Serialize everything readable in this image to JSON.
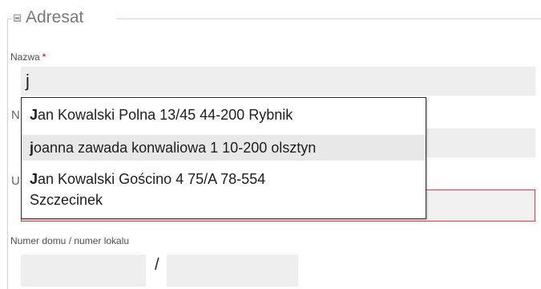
{
  "fieldset": {
    "legend": "Adresat",
    "collapse_icon": "minus-box-icon"
  },
  "fields": {
    "name_label": "Nazwa",
    "name_required_mark": "*",
    "name_value": "j",
    "house_label": "Numer domu / numer lokalu",
    "house_separator": "/",
    "hidden_label_initial_1": "N",
    "hidden_label_initial_2": "U"
  },
  "autocomplete": {
    "items": [
      {
        "match": "J",
        "rest": "an Kowalski Polna 13/45 44-200 Rybnik",
        "highlighted": false
      },
      {
        "match": "j",
        "rest": "oanna zawada konwaliowa 1 10-200 olsztyn",
        "highlighted": true
      },
      {
        "match": "J",
        "rest": "an Kowalski Gościno 4 75/A 78-554",
        "rest_line2": "Szczecinek",
        "highlighted": false
      }
    ]
  },
  "colors": {
    "error_border": "#e23b3b",
    "required": "#cc0000",
    "highlight": "#e8e8e8"
  }
}
